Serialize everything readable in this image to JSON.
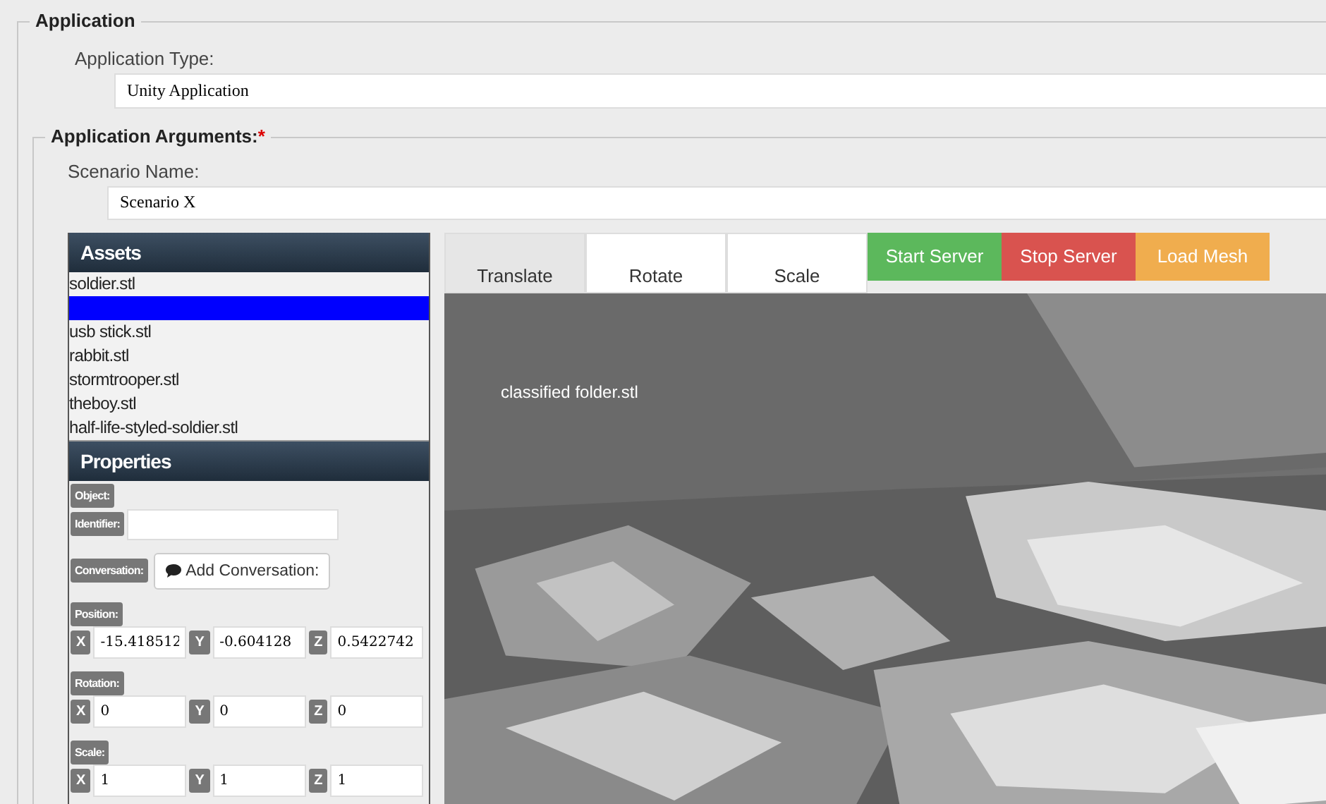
{
  "application": {
    "legend": "Application",
    "type_label": "Application Type:",
    "type_value": "Unity Application",
    "arguments": {
      "legend": "Application Arguments:",
      "required_mark": "*",
      "scenario_label": "Scenario Name:",
      "scenario_value": "Scenario X"
    }
  },
  "assets": {
    "title": "Assets",
    "items": [
      {
        "label": "soldier.stl",
        "selected": false
      },
      {
        "selected": true
      },
      {
        "label": "usb stick.stl",
        "selected": false
      },
      {
        "label": "rabbit.stl",
        "selected": false
      },
      {
        "label": "stormtrooper.stl",
        "selected": false
      },
      {
        "label": "theboy.stl",
        "selected": false
      },
      {
        "label": "half-life-styled-soldier.stl",
        "selected": false
      }
    ]
  },
  "properties": {
    "title": "Properties",
    "object_label": "Object:",
    "identifier_label": "Identifier:",
    "conversation_label": "Conversation:",
    "conversation_button": "Add Conversation:",
    "groups": [
      {
        "label": "Position:",
        "axes": [
          {
            "axis": "X",
            "value": "-15.418512"
          },
          {
            "axis": "Y",
            "value": "-0.604128"
          },
          {
            "axis": "Z",
            "value": "0.5422742"
          }
        ]
      },
      {
        "label": "Rotation:",
        "axes": [
          {
            "axis": "X",
            "value": "0"
          },
          {
            "axis": "Y",
            "value": "0"
          },
          {
            "axis": "Z",
            "value": "0"
          }
        ]
      },
      {
        "label": "Scale:",
        "axes": [
          {
            "axis": "X",
            "value": "1"
          },
          {
            "axis": "Y",
            "value": "1"
          },
          {
            "axis": "Z",
            "value": "1"
          }
        ]
      }
    ]
  },
  "viewer": {
    "tabs": [
      {
        "label": "Translate",
        "selected": true
      },
      {
        "label": "Rotate",
        "selected": false
      },
      {
        "label": "Scale",
        "selected": false
      }
    ],
    "buttons": [
      {
        "label": "Start Server",
        "kind": "success"
      },
      {
        "label": "Stop Server",
        "kind": "danger"
      },
      {
        "label": "Load Mesh",
        "kind": "warning"
      }
    ],
    "overlay_text": "classified folder.stl"
  }
}
